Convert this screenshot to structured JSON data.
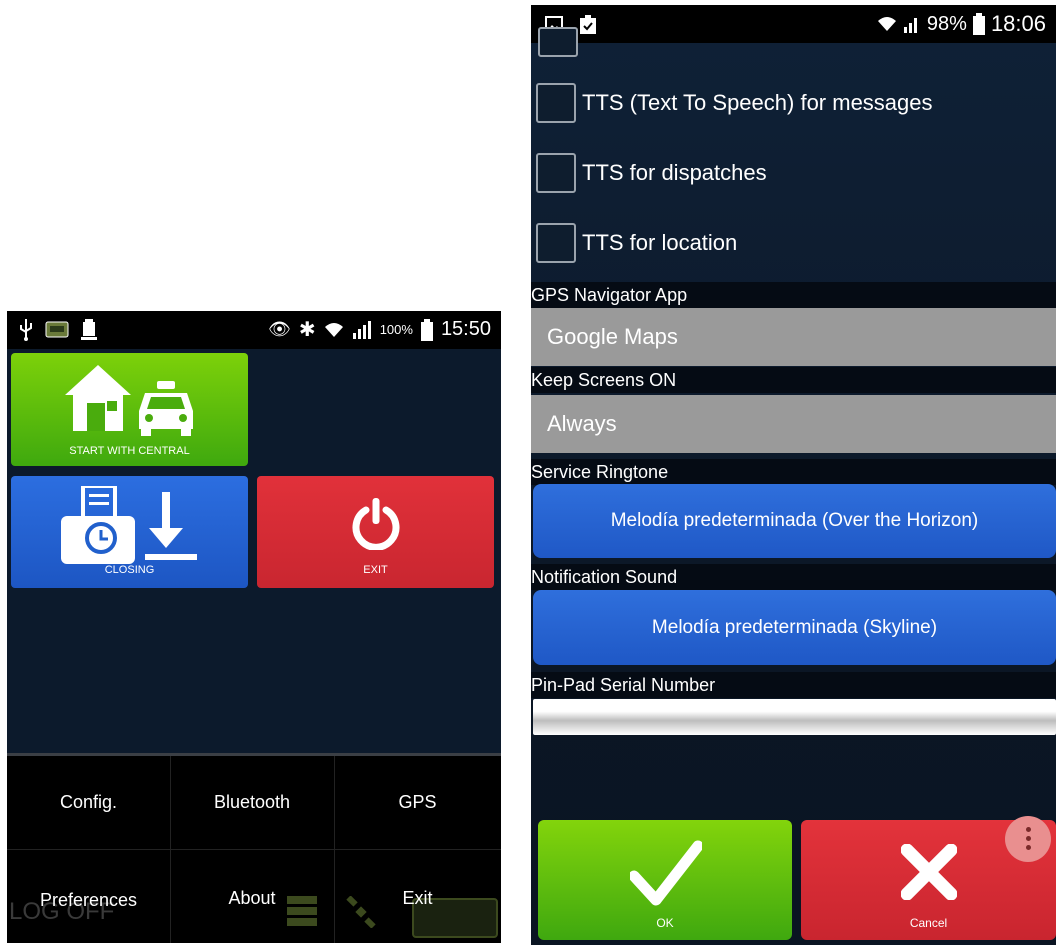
{
  "left": {
    "status_bar": {
      "battery": "100%",
      "time": "15:50"
    },
    "tiles": {
      "start_with_central": "START WITH CENTRAL",
      "closing": "CLOSING",
      "exit": "EXIT"
    },
    "menu": {
      "config": "Config.",
      "bluetooth": "Bluetooth",
      "gps": "GPS",
      "preferences": "Preferences",
      "about": "About",
      "exit": "Exit",
      "log_off": "LOG OFF"
    }
  },
  "right": {
    "status_bar": {
      "battery": "98%",
      "time": "18:06"
    },
    "checkboxes": [
      {
        "label": "TTS (Text To Speech) for messages",
        "checked": false
      },
      {
        "label": "TTS for dispatches",
        "checked": false
      },
      {
        "label": "TTS for location",
        "checked": false
      }
    ],
    "gps_navigator": {
      "label": "GPS Navigator App",
      "value": "Google Maps"
    },
    "keep_screens": {
      "label": "Keep Screens ON",
      "value": "Always"
    },
    "service_ringtone": {
      "label": "Service Ringtone",
      "value": "Melodía predeterminada (Over the Horizon)"
    },
    "notification_sound": {
      "label": "Notification Sound",
      "value": "Melodía predeterminada (Skyline)"
    },
    "pin_pad": {
      "label": "Pin-Pad Serial Number",
      "value": ""
    },
    "ok_label": "OK",
    "cancel_label": "Cancel"
  },
  "colors": {
    "green": "#4fb80a",
    "blue": "#2563d2",
    "red": "#d42b2f",
    "gray_field": "#9a9a9a"
  }
}
